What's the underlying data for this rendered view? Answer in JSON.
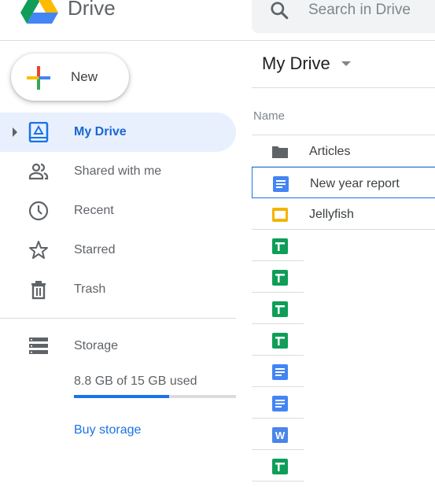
{
  "app": {
    "name": "Drive"
  },
  "search": {
    "placeholder": "Search in Drive"
  },
  "new_button": {
    "label": "New"
  },
  "sidebar": {
    "items": [
      {
        "label": "My Drive",
        "icon": "my-drive-icon",
        "active": true
      },
      {
        "label": "Shared with me",
        "icon": "shared-people-icon"
      },
      {
        "label": "Recent",
        "icon": "clock-icon"
      },
      {
        "label": "Starred",
        "icon": "star-icon"
      },
      {
        "label": "Trash",
        "icon": "trash-icon"
      }
    ],
    "storage": {
      "label": "Storage",
      "used_text": "8.8 GB of 15 GB used",
      "used_fraction": 0.587,
      "buy_label": "Buy storage"
    }
  },
  "main": {
    "title": "My Drive",
    "column_header": "Name",
    "files": [
      {
        "name": "Articles",
        "type": "folder"
      },
      {
        "name": "New year report",
        "type": "docs",
        "selected": true
      },
      {
        "name": "Jellyfish",
        "type": "slides"
      },
      {
        "name": "",
        "type": "sheets"
      },
      {
        "name": "",
        "type": "sheets"
      },
      {
        "name": "",
        "type": "sheets"
      },
      {
        "name": "",
        "type": "sheets"
      },
      {
        "name": "",
        "type": "docs"
      },
      {
        "name": "",
        "type": "docs"
      },
      {
        "name": "",
        "type": "word"
      },
      {
        "name": "",
        "type": "sheets"
      }
    ]
  },
  "colors": {
    "accent": "#1a73e8",
    "active_bg": "#e8f0fe",
    "docs": "#4285f4",
    "sheets": "#0f9d58",
    "slides": "#f4b400",
    "folder": "#5f6368"
  }
}
